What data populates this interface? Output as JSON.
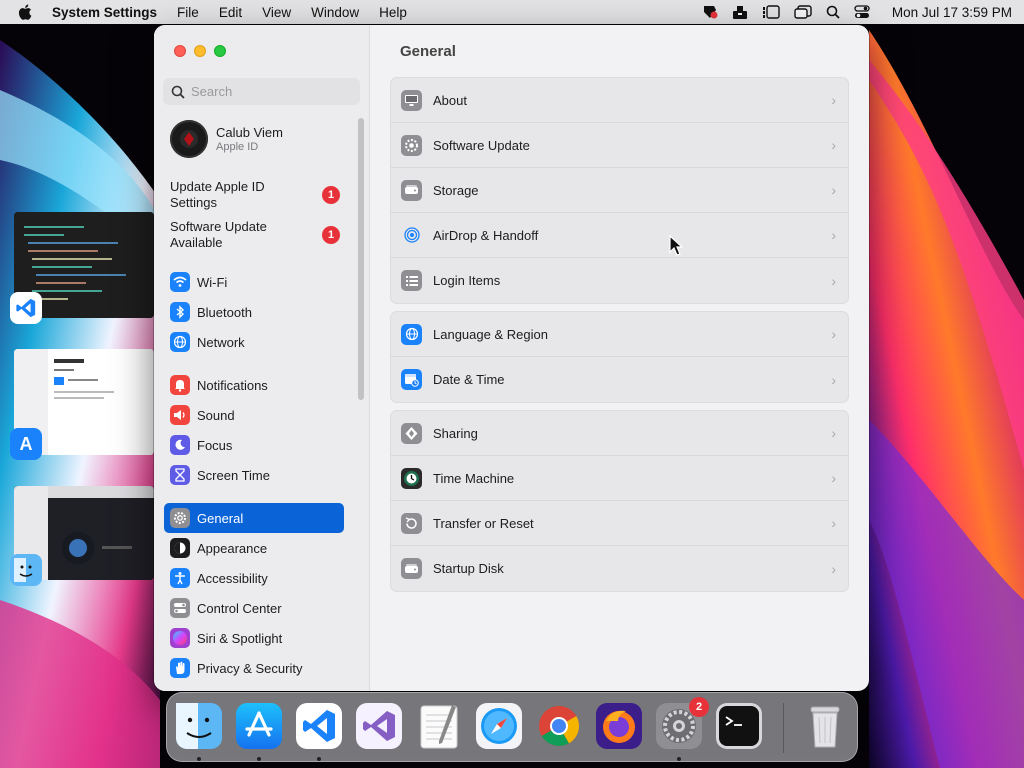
{
  "menubar": {
    "app_name": "System Settings",
    "items": [
      "File",
      "Edit",
      "View",
      "Window",
      "Help"
    ],
    "clock": "Mon Jul 17  3:59 PM"
  },
  "window": {
    "search_placeholder": "Search",
    "profile": {
      "name": "Calub Viem",
      "subtitle": "Apple ID"
    },
    "notices": [
      {
        "line1": "Update Apple ID",
        "line2": "Settings",
        "badge": "1"
      },
      {
        "line1": "Software Update",
        "line2": "Available",
        "badge": "1"
      }
    ],
    "sidebar": [
      {
        "label": "Wi-Fi",
        "icon": "wifi-icon",
        "color": "#1a82fb"
      },
      {
        "label": "Bluetooth",
        "icon": "bluetooth-icon",
        "color": "#1a82fb"
      },
      {
        "label": "Network",
        "icon": "globe-icon",
        "color": "#1a82fb"
      },
      {
        "label": "Notifications",
        "icon": "bell-icon",
        "color": "#f2453d"
      },
      {
        "label": "Sound",
        "icon": "speaker-icon",
        "color": "#f2453d"
      },
      {
        "label": "Focus",
        "icon": "moon-icon",
        "color": "#5e5ce6"
      },
      {
        "label": "Screen Time",
        "icon": "hourglass-icon",
        "color": "#5e5ce6"
      },
      {
        "label": "General",
        "icon": "gear-icon",
        "color": "#8e8e93",
        "selected": true
      },
      {
        "label": "Appearance",
        "icon": "appearance-icon",
        "color": "#1d1d1f"
      },
      {
        "label": "Accessibility",
        "icon": "accessibility-icon",
        "color": "#1a82fb"
      },
      {
        "label": "Control Center",
        "icon": "toggles-icon",
        "color": "#8e8e93"
      },
      {
        "label": "Siri & Spotlight",
        "icon": "siri-icon",
        "color": "#a040d0"
      },
      {
        "label": "Privacy & Security",
        "icon": "hand-icon",
        "color": "#1a82fb"
      }
    ],
    "title": "General",
    "groups": [
      [
        {
          "label": "About",
          "icon": "display-icon",
          "color": "#8e8e93"
        },
        {
          "label": "Software Update",
          "icon": "gear-badge-icon",
          "color": "#8e8e93"
        },
        {
          "label": "Storage",
          "icon": "drive-icon",
          "color": "#8e8e93"
        },
        {
          "label": "AirDrop & Handoff",
          "icon": "airdrop-icon",
          "color": "#e7e7e9"
        },
        {
          "label": "Login Items",
          "icon": "list-icon",
          "color": "#8e8e93"
        }
      ],
      [
        {
          "label": "Language & Region",
          "icon": "globe-icon",
          "color": "#1a82fb"
        },
        {
          "label": "Date & Time",
          "icon": "calendar-clock-icon",
          "color": "#1a82fb"
        }
      ],
      [
        {
          "label": "Sharing",
          "icon": "sharing-icon",
          "color": "#8e8e93"
        },
        {
          "label": "Time Machine",
          "icon": "time-machine-icon",
          "color": "#2a2a2a"
        },
        {
          "label": "Transfer or Reset",
          "icon": "reset-icon",
          "color": "#8e8e93"
        },
        {
          "label": "Startup Disk",
          "icon": "drive-icon",
          "color": "#8e8e93"
        }
      ]
    ]
  },
  "dock": {
    "apps": [
      {
        "name": "Finder",
        "icon": "finder-icon",
        "running": true
      },
      {
        "name": "App Store",
        "icon": "app-store-icon",
        "running": true
      },
      {
        "name": "Visual Studio Code",
        "icon": "vscode-icon",
        "running": true
      },
      {
        "name": "Visual Studio",
        "icon": "visual-studio-icon",
        "running": false
      },
      {
        "name": "TextEdit",
        "icon": "textedit-icon",
        "running": false
      },
      {
        "name": "Safari",
        "icon": "safari-icon",
        "running": false
      },
      {
        "name": "Chrome",
        "icon": "chrome-icon",
        "running": false
      },
      {
        "name": "Firefox",
        "icon": "firefox-icon",
        "running": false
      },
      {
        "name": "System Settings",
        "icon": "system-settings-icon",
        "running": true,
        "badge": "2"
      },
      {
        "name": "Terminal",
        "icon": "terminal-icon",
        "running": false
      }
    ],
    "trash": "trash-icon"
  }
}
